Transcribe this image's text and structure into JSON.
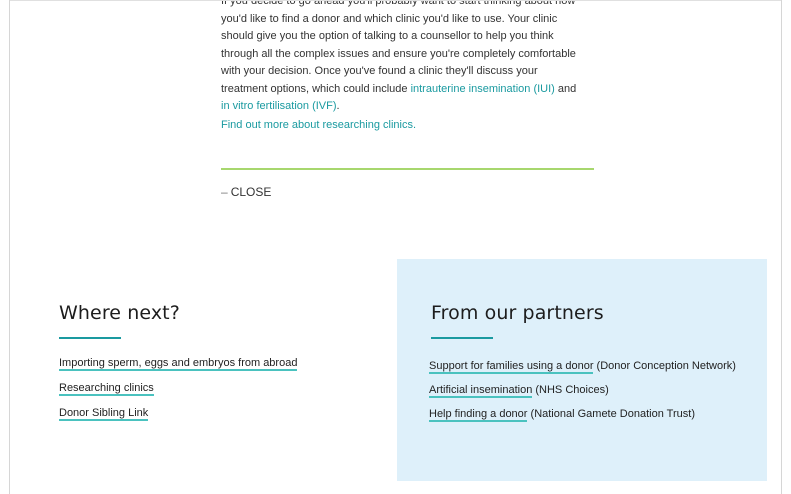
{
  "article": {
    "cut_line": "If you decide to go ahead you'll probably want to start thinking about how",
    "lines": [
      {
        "text": "you'd like to find a donor and which clinic you'd like to use. Your clinic"
      },
      {
        "text": "should give you the option of talking to a counsellor to help you think"
      },
      {
        "text": "through all the complex issues and ensure you're completely comfortable"
      },
      {
        "text": "with your decision. Once you've found a clinic they'll discuss your"
      }
    ],
    "line5_prefix": "treatment options, which could include ",
    "iui_link": "intrauterine insemination (IUI)",
    "line5_suffix": " and",
    "ivf_link": "in vitro fertilisation (IVF)",
    "line6_suffix": ".",
    "find_more_link": "Find out more about researching clinics.",
    "close_dash": "–",
    "close_label": "CLOSE"
  },
  "where_next": {
    "title": "Where next?",
    "links": [
      "Importing sperm, eggs and embryos from abroad",
      "Researching clinics",
      "Donor Sibling Link"
    ]
  },
  "partners": {
    "title": "From our partners",
    "links": [
      {
        "anchor": "Support for families using a donor",
        "source": " (Donor Conception Network)"
      },
      {
        "anchor": "Artificial insemination",
        "source": " (NHS Choices)"
      },
      {
        "anchor": "Help finding a donor",
        "source": " (National Gamete Donation Trust)"
      }
    ]
  },
  "colors": {
    "accent_teal": "#1a9aa0",
    "underline_teal": "#4ac2bf",
    "green_rule": "#a7d76e",
    "partners_bg": "#def0fa"
  }
}
